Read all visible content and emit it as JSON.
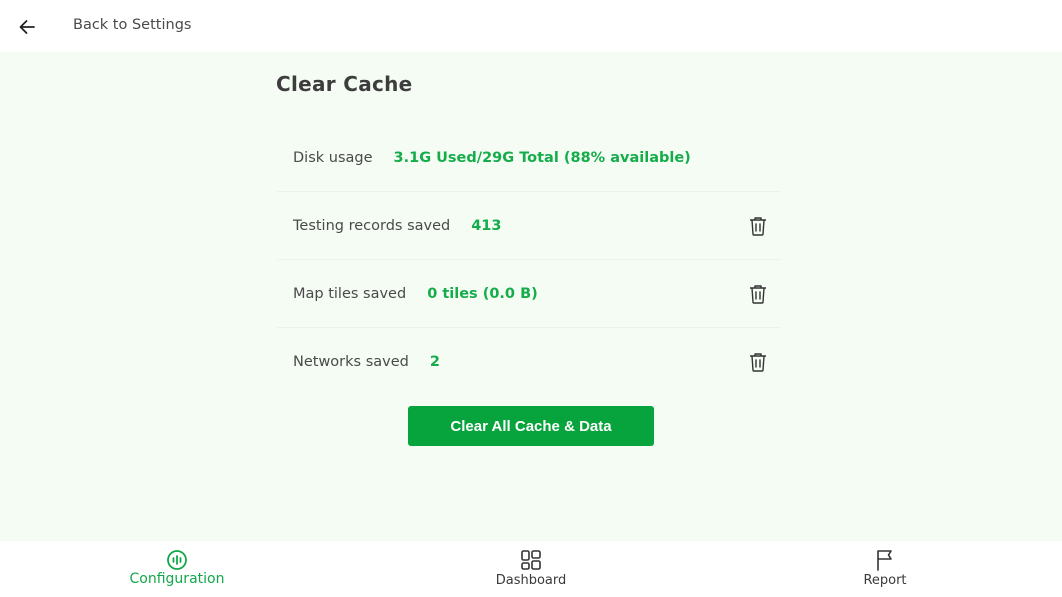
{
  "header": {
    "back_label": "Back to Settings",
    "back_icon": "arrow-left-icon"
  },
  "main": {
    "title": "Clear Cache",
    "rows": [
      {
        "label": "Disk usage",
        "value": "3.1G Used/29G Total (88% available)",
        "deletable": false
      },
      {
        "label": "Testing records saved",
        "value": "413",
        "deletable": true
      },
      {
        "label": "Map tiles saved",
        "value": "0 tiles (0.0 B)",
        "deletable": true
      },
      {
        "label": "Networks saved",
        "value": "2",
        "deletable": true
      }
    ],
    "clear_button_label": "Clear All Cache & Data"
  },
  "bottom_nav": {
    "items": [
      {
        "label": "Configuration",
        "icon": "configuration-icon",
        "active": true
      },
      {
        "label": "Dashboard",
        "icon": "dashboard-icon",
        "active": false
      },
      {
        "label": "Report",
        "icon": "flag-icon",
        "active": false
      }
    ]
  },
  "colors": {
    "accent": "#07a33c",
    "value_text": "#15ad4b",
    "content_background": "#f5fcf4"
  }
}
